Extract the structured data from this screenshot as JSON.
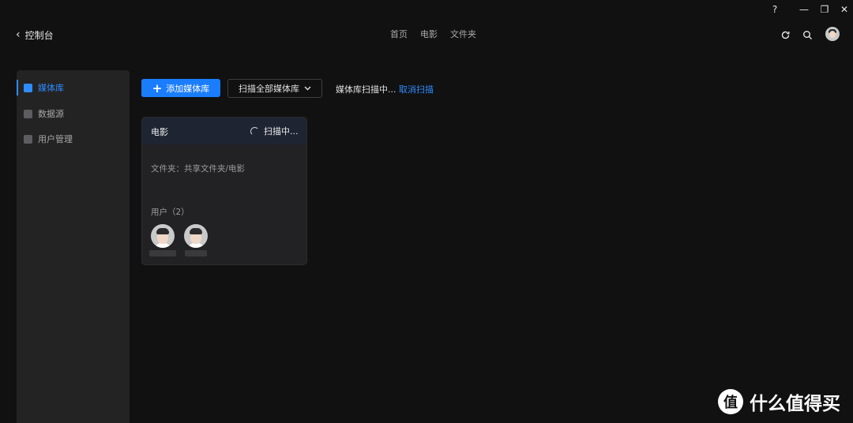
{
  "window_controls": {
    "help": "?",
    "minimize": "—",
    "restore": "❐",
    "close": "✕"
  },
  "header": {
    "back_label": "控制台",
    "nav": [
      "首页",
      "电影",
      "文件夹"
    ],
    "icons": [
      "refresh-icon",
      "search-icon",
      "avatar"
    ]
  },
  "sidebar": {
    "items": [
      {
        "label": "媒体库",
        "icon": "media-library-icon",
        "active": true
      },
      {
        "label": "数据源",
        "icon": "data-source-icon",
        "active": false
      },
      {
        "label": "用户管理",
        "icon": "user-management-icon",
        "active": false
      }
    ]
  },
  "toolbar": {
    "add_label": "添加媒体库",
    "scan_all_label": "扫描全部媒体库",
    "scan_status": "媒体库扫描中...",
    "cancel_label": "取消扫描"
  },
  "library_card": {
    "title": "电影",
    "status": "扫描中...",
    "folder_text": "文件夹：共享文件夹/电影",
    "users_label": "用户（2）",
    "users_count": 2
  },
  "watermark": {
    "logo_char": "值",
    "text": "什么值得买"
  },
  "colors": {
    "accent": "#1a7dfd",
    "link": "#2f8cff",
    "background": "#111112",
    "panel": "#232324"
  }
}
